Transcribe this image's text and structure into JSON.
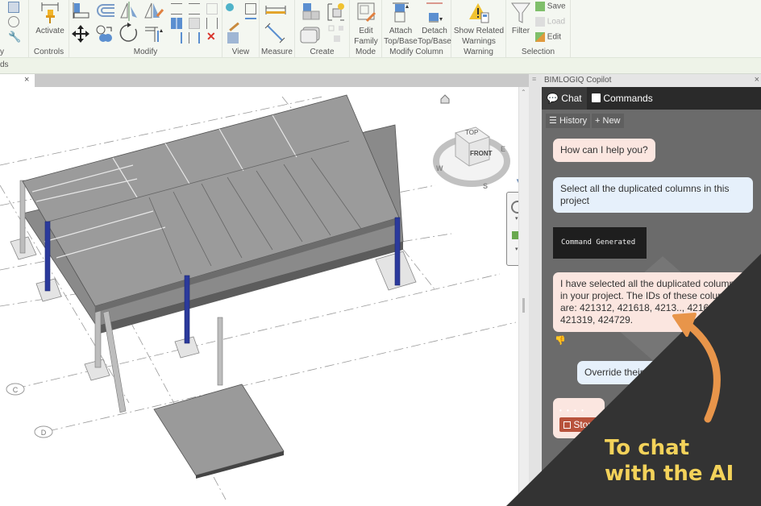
{
  "ribbon": {
    "panels": [
      {
        "title": "Controls",
        "buttons": [
          {
            "label": "Activate"
          }
        ]
      },
      {
        "title": "Modify"
      },
      {
        "title": "View"
      },
      {
        "title": "Measure"
      },
      {
        "title": "Create"
      },
      {
        "title": "Mode",
        "buttons": [
          {
            "label": "Edit Family"
          }
        ]
      },
      {
        "title": "Modify Column",
        "buttons": [
          {
            "label": "Attach Top/Base"
          },
          {
            "label": "Detach Top/Base"
          }
        ]
      },
      {
        "title": "Warning",
        "buttons": [
          {
            "label": "Show Related Warnings"
          }
        ]
      },
      {
        "title": "Selection",
        "buttons": [
          {
            "label": "Filter"
          },
          {
            "label": "Save"
          },
          {
            "label": "Load"
          },
          {
            "label": "Edit"
          }
        ]
      }
    ],
    "options_bar_fragment": "ds",
    "left_cut_panel_title_fragment": "y"
  },
  "view": {
    "tab_close": "×",
    "viewcube": {
      "top": "TOP",
      "front": "FRONT",
      "compass": {
        "w": "W",
        "s": "S",
        "e": "E"
      }
    },
    "grid_labels": [
      "C",
      "D"
    ],
    "column_color": "#2b3a9c"
  },
  "copilot": {
    "title": "BIMLOGIQ Copilot",
    "close": "×",
    "tabs": [
      {
        "label": "Chat",
        "active": true
      },
      {
        "label": "Commands",
        "active": false
      }
    ],
    "tools": [
      {
        "label": "History"
      },
      {
        "label": "New"
      }
    ],
    "messages": [
      {
        "role": "ai",
        "text": "How can I help you?"
      },
      {
        "role": "user",
        "text": "Select all the duplicated columns in this project"
      },
      {
        "role": "command",
        "text": "Command Generated"
      },
      {
        "role": "ai",
        "text": "I have selected all the duplicated columns in your project. The IDs of these columns are: 421312, 421618, 4213.., 421619, 421319, 424729."
      },
      {
        "role": "user",
        "text": "Override their g..."
      }
    ],
    "stop_label": "Stop",
    "typing_dots": "• • • •"
  },
  "overlay": {
    "line1": "To chat",
    "line2": "with the AI",
    "text_color": "#f3d25a",
    "arrow_color": "#e8954a",
    "bg_color": "#333333"
  }
}
